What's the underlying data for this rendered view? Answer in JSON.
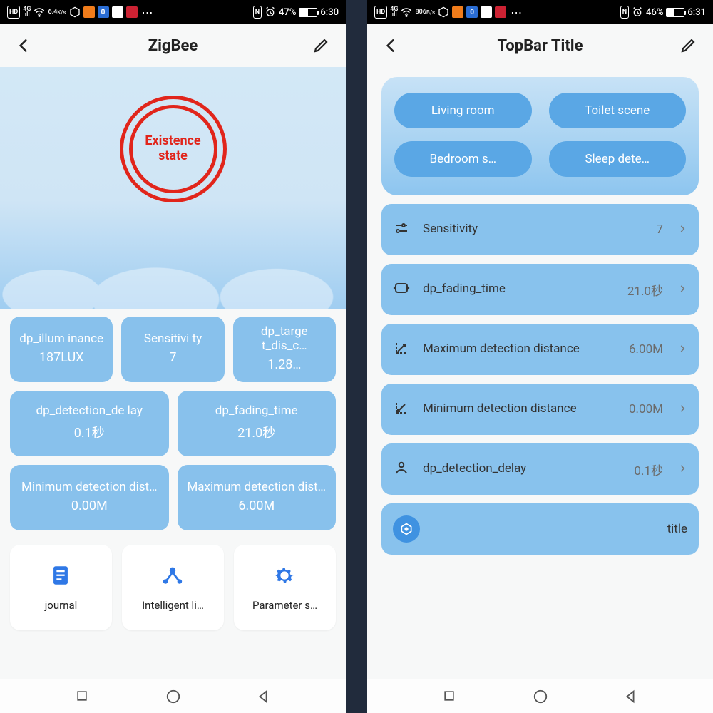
{
  "left": {
    "statusbar": {
      "speed_top": "6.4",
      "speed_bot": "K/s",
      "battery_pct": "47%",
      "clock": "6:30",
      "nfc": "N"
    },
    "title": "ZigBee",
    "hero_label": "Existence\nstate",
    "tiles": {
      "illum_label": "dp_illum inance",
      "illum_val": "187LUX",
      "sens_label": "Sensitivi ty",
      "sens_val": "7",
      "targ_label": "dp_targe t_dis_c…",
      "targ_val": "1.28…",
      "detdel_label": "dp_detection_de lay",
      "detdel_val": "0.1秒",
      "fade_label": "dp_fading_time",
      "fade_val": "21.0秒",
      "min_label": "Minimum detection dist…",
      "min_val": "0.00M",
      "max_label": "Maximum detection dist…",
      "max_val": "6.00M"
    },
    "shortcuts": {
      "journal": "journal",
      "intel": "Intelligent li…",
      "param": "Parameter s…"
    }
  },
  "right": {
    "statusbar": {
      "speed_top": "806",
      "speed_bot": "B/s",
      "battery_pct": "46%",
      "clock": "6:31",
      "nfc": "N"
    },
    "title": "TopBar Title",
    "scenes": {
      "a": "Living room",
      "b": "Toilet scene",
      "c": "Bedroom s…",
      "d": "Sleep dete…"
    },
    "rows": {
      "sens_l": "Sensitivity",
      "sens_v": "7",
      "fade_l": "dp_fading_time",
      "fade_v": "21.0秒",
      "max_l": "Maximum detection distance",
      "max_v": "6.00M",
      "min_l": "Minimum detection distance",
      "min_v": "0.00M",
      "del_l": "dp_detection_delay",
      "del_v": "0.1秒",
      "title_l": "title"
    }
  }
}
